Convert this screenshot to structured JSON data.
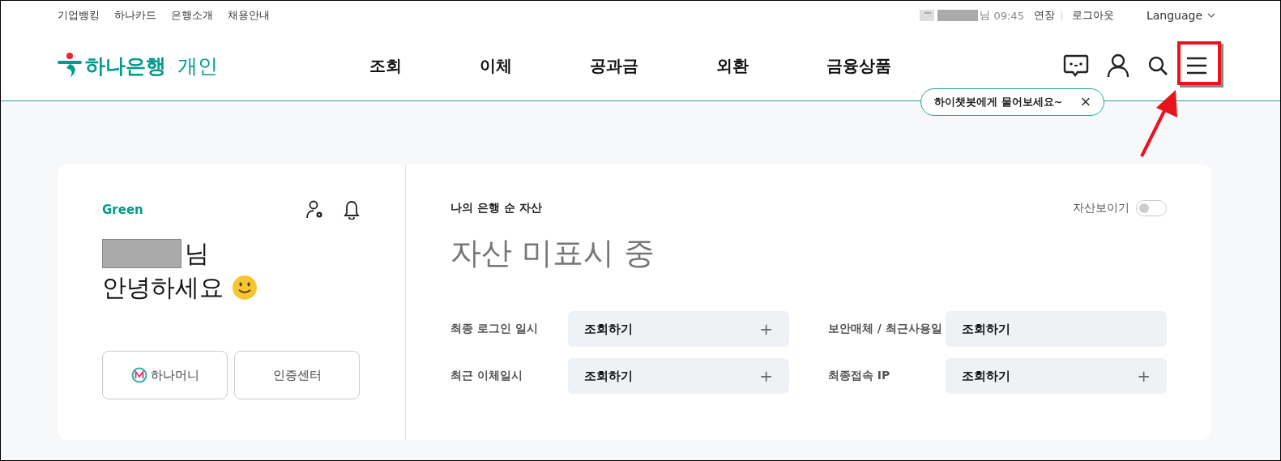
{
  "utility_links": [
    "기업뱅킹",
    "하나카드",
    "은행소개",
    "채용안내"
  ],
  "session": {
    "name_suffix": "님",
    "time": "09:45",
    "extend": "연장",
    "logout": "로그아웃",
    "language": "Language"
  },
  "logo": {
    "brand": "하나은행",
    "section": "개인"
  },
  "nav": [
    "조회",
    "이체",
    "공과금",
    "외환",
    "금융상품"
  ],
  "chatbot_tooltip": {
    "text": "하이챗봇에게 물어보세요~",
    "close": "×"
  },
  "profile": {
    "grade": "Green",
    "name_suffix": "님",
    "greeting": "안녕하세요",
    "buttons": [
      {
        "kind": "money",
        "label": "하나머니"
      },
      {
        "kind": "plain",
        "label": "인증센터"
      }
    ]
  },
  "assets": {
    "title": "나의 은행 순 자산",
    "toggle_label": "자산보이기",
    "toggle_on": false,
    "status": "자산 미표시 중",
    "rows": [
      {
        "label": "최종 로그인 일시",
        "value": "조회하기",
        "action": "+"
      },
      {
        "label": "보안매체 / 최근사용일",
        "value": "조회하기"
      },
      {
        "label": "최근 이체일시",
        "value": "조회하기",
        "action": "+"
      },
      {
        "label": "최종접속 IP",
        "value": "조회하기",
        "action": "+"
      }
    ]
  }
}
